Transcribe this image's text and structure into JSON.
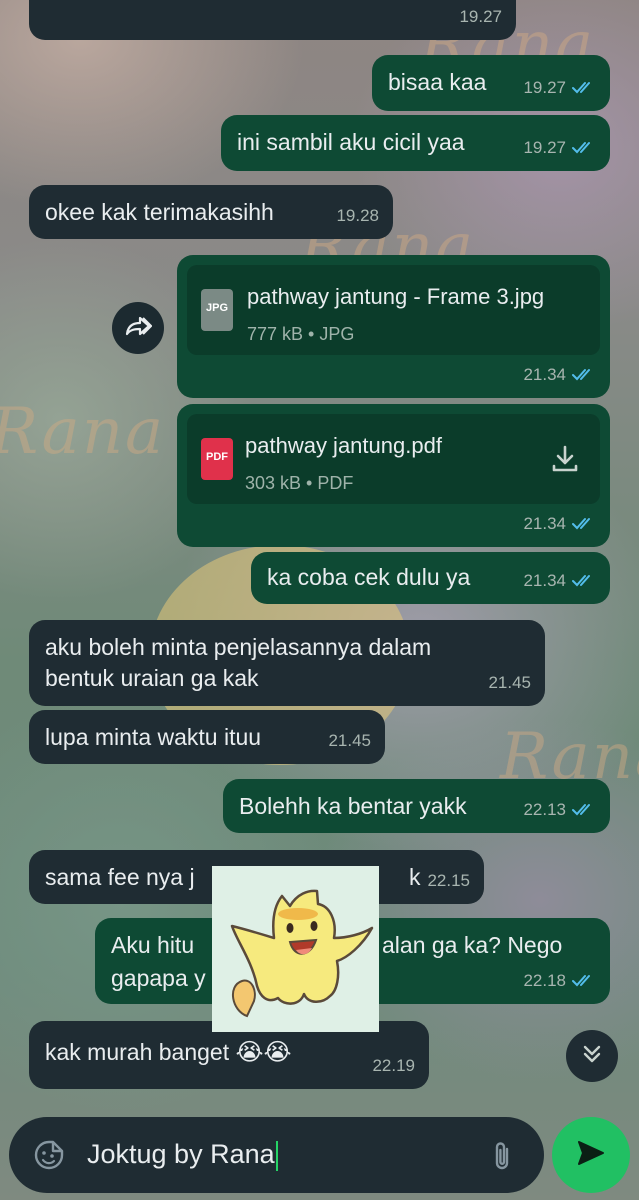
{
  "wallpaper": {
    "watermark": "Rana"
  },
  "messages": [
    {
      "id": "m0",
      "dir": "in",
      "text": "",
      "time": "19.27"
    },
    {
      "id": "m1",
      "dir": "out",
      "text": "bisaa kaa",
      "time": "19.27",
      "read": true
    },
    {
      "id": "m2",
      "dir": "out",
      "text": "ini sambil aku cicil yaa",
      "time": "19.27",
      "read": true
    },
    {
      "id": "m3",
      "dir": "in",
      "text": "okee kak terimakasihh",
      "time": "19.28"
    },
    {
      "id": "m4",
      "dir": "out",
      "type": "file",
      "file_name": "pathway jantung - Frame 3.jpg",
      "file_size": "777 kB",
      "file_type": "JPG",
      "icon": "jpg-file-icon",
      "time": "21.34",
      "read": true
    },
    {
      "id": "m5",
      "dir": "out",
      "type": "file",
      "file_name": "pathway jantung.pdf",
      "file_size": "303 kB",
      "file_type": "PDF",
      "icon": "pdf-file-icon",
      "time": "21.34",
      "read": true
    },
    {
      "id": "m6",
      "dir": "out",
      "text": "ka coba cek dulu ya",
      "time": "21.34",
      "read": true
    },
    {
      "id": "m7",
      "dir": "in",
      "text": "aku boleh minta penjelasannya dalam\nbentuk uraian ga kak",
      "time": "21.45"
    },
    {
      "id": "m8",
      "dir": "in",
      "text": "lupa minta waktu ituu",
      "time": "21.45"
    },
    {
      "id": "m9",
      "dir": "out",
      "text": "Bolehh ka bentar yakk",
      "time": "22.13",
      "read": true
    },
    {
      "id": "m10",
      "dir": "in",
      "text_left": "sama fee nya j",
      "text_right": "k",
      "time": "22.15"
    },
    {
      "id": "m11",
      "dir": "out",
      "text_left": "Aku hitu",
      "text_right": "alan ga ka? Nego",
      "text_line2": "gapapa y",
      "time": "22.18",
      "read": true
    },
    {
      "id": "m12",
      "dir": "in",
      "text": "kak murah banget",
      "emoji": "😭😭",
      "time": "22.19"
    }
  ],
  "sticker": {
    "icon": "cat-ghost-sticker"
  },
  "composer": {
    "text": "Joktug by Rana"
  },
  "colors": {
    "incoming_bubble": "#1f2c33",
    "outgoing_bubble": "#0e4a34",
    "send_button": "#21c063",
    "read_ticks": "#53bdeb",
    "pdf_icon": "#e0314b",
    "jpg_icon": "#7b8a85"
  }
}
